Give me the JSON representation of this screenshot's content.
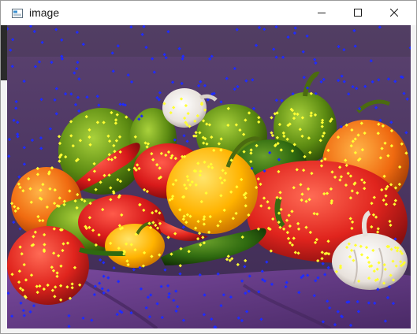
{
  "window": {
    "title": "image",
    "app_icon": "opencv-window-icon",
    "controls": {
      "minimize": "minimize-icon",
      "maximize": "maximize-icon",
      "close": "close-icon"
    }
  },
  "image": {
    "description_icon": "peppers-image",
    "colors": {
      "background": "#5a3a6e",
      "cloth": "#6b3f8c",
      "feature_inside": "#ffff33",
      "feature_outside": "#1f2bff"
    }
  }
}
